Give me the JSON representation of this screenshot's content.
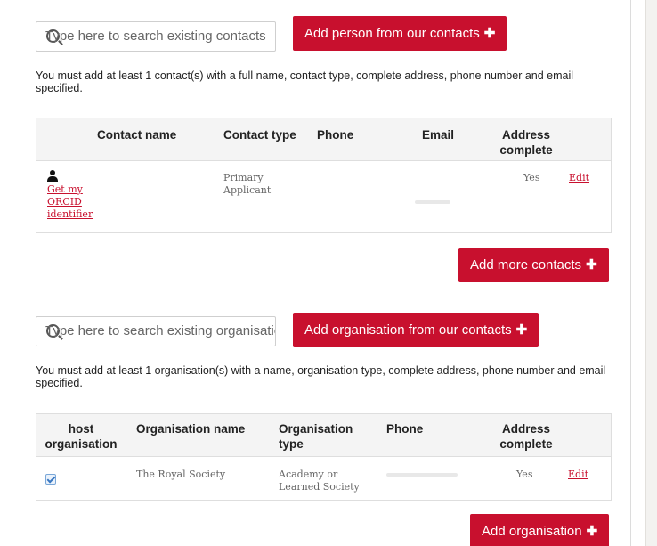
{
  "contacts": {
    "search_placeholder": "Type here to search existing contacts",
    "add_button": "Add person from our contacts",
    "requirement_note": "You must add at least 1 contact(s) with a full name, contact type, complete address, phone number and email specified.",
    "table": {
      "headers": [
        "Contact name",
        "Contact type",
        "Phone",
        "Email",
        "Address complete"
      ],
      "rows": [
        {
          "orcid_link": "Get my ORCID identifier",
          "contact_type": "Primary Applicant",
          "address_complete": "Yes",
          "edit_label": "Edit"
        }
      ]
    },
    "add_more_button": "Add more contacts"
  },
  "organisations": {
    "search_placeholder": "Type here to search existing organisations",
    "add_button": "Add organisation from our contacts",
    "requirement_note": "You must add at least 1 organisation(s) with a name, organisation type, complete address, phone number and email specified.",
    "table": {
      "headers": [
        "host organisation",
        "Organisation name",
        "Organisation type",
        "Phone",
        "Address complete"
      ],
      "rows": [
        {
          "host_checked": true,
          "name": "The Royal Society",
          "type": "Academy or Learned Society",
          "address_complete": "Yes",
          "edit_label": "Edit"
        }
      ]
    },
    "add_button_bottom": "Add organisation"
  },
  "plus_glyph": "✚",
  "colors": {
    "accent": "#c8102e",
    "header_bg": "#f4f4f4",
    "border": "#dedede"
  },
  "icons": {
    "search": "search-icon",
    "person": "person-icon",
    "plus": "plus-icon",
    "checkbox": "checkbox-checked-icon"
  }
}
